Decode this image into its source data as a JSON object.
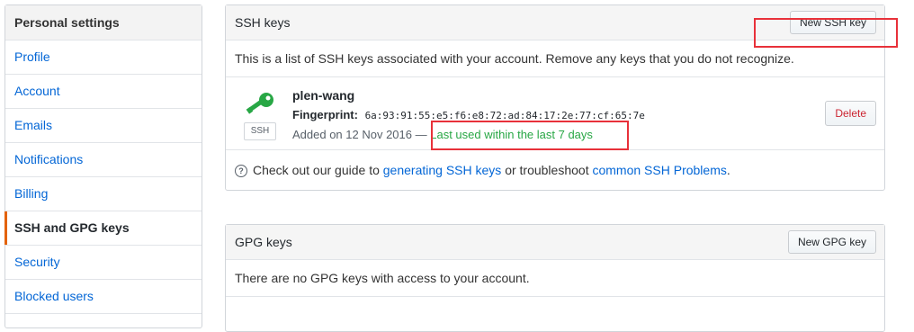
{
  "sidebar": {
    "title": "Personal settings",
    "items": [
      {
        "label": "Profile"
      },
      {
        "label": "Account"
      },
      {
        "label": "Emails"
      },
      {
        "label": "Notifications"
      },
      {
        "label": "Billing"
      },
      {
        "label": "SSH and GPG keys",
        "selected": true
      },
      {
        "label": "Security"
      },
      {
        "label": "Blocked users"
      }
    ]
  },
  "ssh": {
    "title": "SSH keys",
    "new_button": "New SSH key",
    "description": "This is a list of SSH keys associated with your account. Remove any keys that you do not recognize.",
    "key": {
      "name": "plen-wang",
      "badge": "SSH",
      "fingerprint_label": "Fingerprint:",
      "fingerprint": "6a:93:91:55:e5:f6:e8:72:ad:84:17:2e:77:cf:65:7e",
      "added": "Added on 12 Nov 2016",
      "separator": "—",
      "last_used": "Last used within the last 7 days",
      "delete_button": "Delete"
    },
    "help": {
      "prefix": "Check out our guide to",
      "link1": "generating SSH keys",
      "middle": "or troubleshoot",
      "link2": "common SSH Problems",
      "suffix": "."
    }
  },
  "gpg": {
    "title": "GPG keys",
    "new_button": "New GPG key",
    "description": "There are no GPG keys with access to your account."
  },
  "colors": {
    "link": "#0366d6",
    "accent": "#e36209",
    "success": "#28a745",
    "danger": "#cb2431",
    "annotation": "#e8313a"
  }
}
